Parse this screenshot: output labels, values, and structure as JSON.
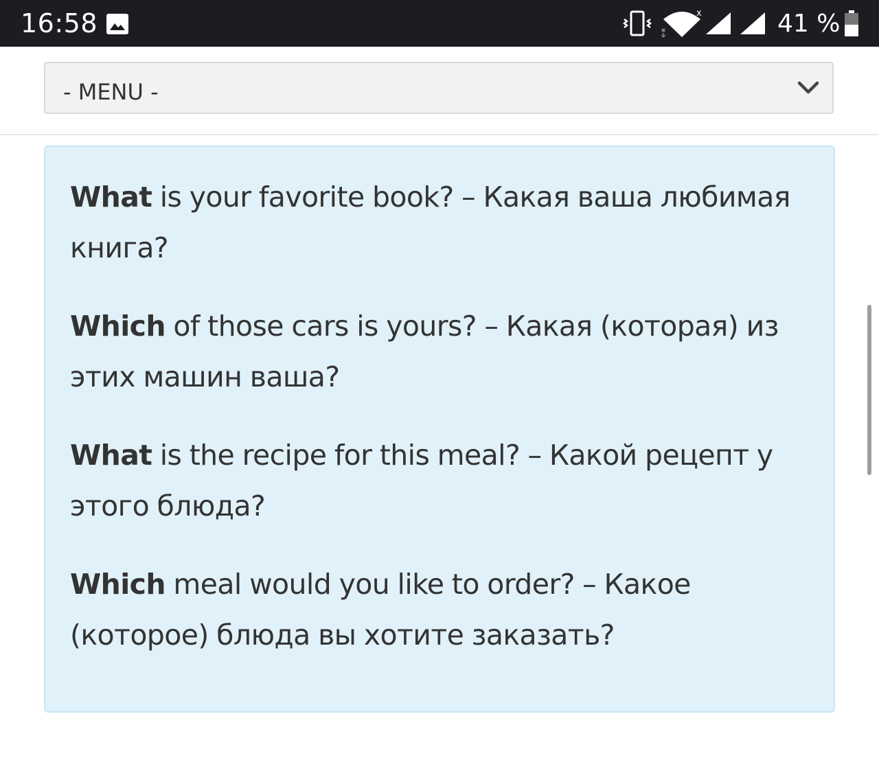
{
  "status_bar": {
    "time": "16:58",
    "battery_level": "41 %",
    "icons": [
      "gallery-icon",
      "vibrate-icon",
      "wifi-icon",
      "signal-icon",
      "signal-icon",
      "battery-icon"
    ]
  },
  "menu": {
    "selected": "- MENU -",
    "icon": "chevron-down-icon"
  },
  "examples": [
    {
      "keyword": "What",
      "rest": " is your favorite book? – Какая ваша любимая книга?"
    },
    {
      "keyword": "Which",
      "rest": " of those cars is yours? – Какая (которая) из этих машин ваша?"
    },
    {
      "keyword": "What",
      "rest": " is the recipe for this meal? – Какой рецепт у этого блюда?"
    },
    {
      "keyword": "Which",
      "rest": " meal would you like to order? – Какое (которое) блюда вы хотите заказать?"
    }
  ],
  "colors": {
    "status_bar": "#1c1c21",
    "info_box_bg": "#e1f1f9",
    "info_box_border": "#c7e6f3",
    "text": "#333333"
  }
}
